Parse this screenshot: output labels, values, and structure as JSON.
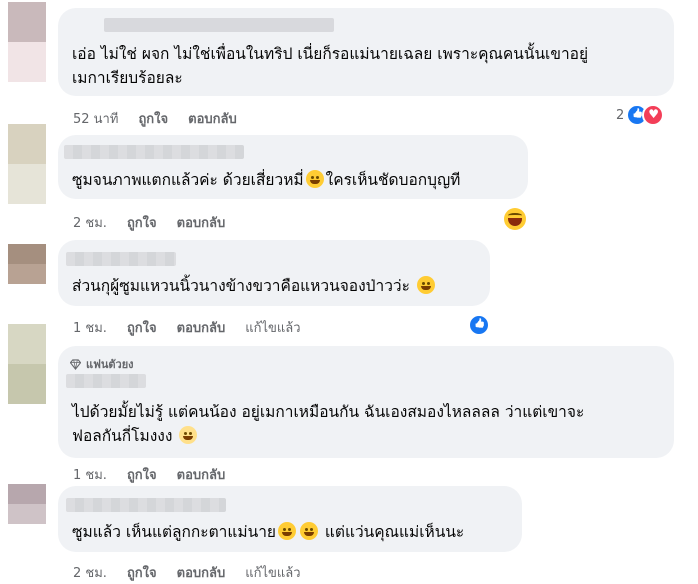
{
  "comments": [
    {
      "text_lines": [
        "เอ่อ ไม่ใช่ ผจก ไม่ใช่เพื่อนในทริป เนี่ยก็รอแม่นายเฉลย เพราะคุณคนนั้นเขาอยู่",
        "เมกาเรียบร้อยละ"
      ],
      "time": "52 นาที",
      "like_label": "ถูกใจ",
      "reply_label": "ตอบกลับ",
      "reaction_count": "2",
      "avatar_colors": [
        "#c9b9bb",
        "#f1e4e6"
      ]
    },
    {
      "text_lines": [
        "ซูมจนภาพแตกแล้วค่ะ ด้วยเสี่ยวหมี่",
        "ใครเห็นชัดบอกบุญที"
      ],
      "time": "2 ชม.",
      "like_label": "ถูกใจ",
      "reply_label": "ตอบกลับ",
      "avatar_colors": [
        "#d8d2bf",
        "#e6e4d8"
      ]
    },
    {
      "text_lines": [
        "ส่วนกุผู้ซูมแหวนนิ้วนางข้างขวาคือแหวนจองป่าวว่ะ"
      ],
      "time": "1 ชม.",
      "like_label": "ถูกใจ",
      "reply_label": "ตอบกลับ",
      "edited_label": "แก้ไขแล้ว",
      "avatar_colors": [
        "#a58f7f",
        "#b8a293"
      ]
    },
    {
      "badge": "แฟนตัวยง",
      "text_lines": [
        "ไปด้วยมั้ยไม่รู้ แต่คนน้อง อยู่เมกาเหมือนกัน ฉันเองสมองไหลลลล ว่าแต่เขาจะ",
        "ฟอลกันกี่โมงงง"
      ],
      "time": "1 ชม.",
      "like_label": "ถูกใจ",
      "reply_label": "ตอบกลับ",
      "avatar_colors": [
        "#d7d7c3",
        "#c6c7ad"
      ]
    },
    {
      "text_lines": [
        "ซูมแล้ว เห็นแต่ลูกกะตาแม่นาย",
        "แต่แว่นคุณแม่เห็นนะ"
      ],
      "time": "2 ชม.",
      "like_label": "ถูกใจ",
      "reply_label": "ตอบกลับ",
      "edited_label": "แก้ไขแล้ว",
      "avatar_colors": [
        "#b7a7ad",
        "#cfc3c7"
      ]
    }
  ],
  "reaction_icons": [
    "like-icon",
    "heart-icon",
    "haha-icon"
  ],
  "colors": {
    "bubble": "#f0f2f5",
    "meta": "#65676b",
    "text": "#050505",
    "like_blue": "#1877f2",
    "love_red": "#f33e58"
  }
}
